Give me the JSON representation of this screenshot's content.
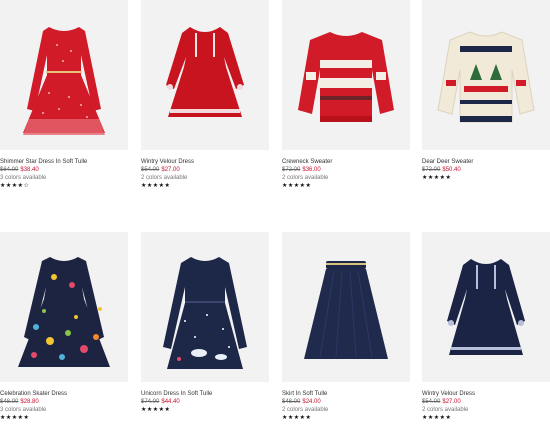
{
  "colors": {
    "sale_price": "#c4122f",
    "card_bg": "#f2f2f2",
    "red": "#d21b28",
    "navy": "#1d2748",
    "cream": "#f1ead9",
    "green": "#2d6b3a"
  },
  "products": [
    {
      "name": "Shimmer Star Dress In Soft Tulle",
      "orig_price": "$64.00",
      "sale_price": "$38.40",
      "colors": "3 colors available",
      "stars": "★★★★☆",
      "rating": 4.5,
      "icon": "red-tulle-dress"
    },
    {
      "name": "Wintry Velour Dress",
      "orig_price": "$54.00",
      "sale_price": "$27.00",
      "colors": "2 colors available",
      "stars": "★★★★★",
      "rating": 5,
      "icon": "red-velour-dress"
    },
    {
      "name": "Crewneck Sweater",
      "orig_price": "$72.00",
      "sale_price": "$36.00",
      "colors": "2 colors available",
      "stars": "★★★★★",
      "rating": 5,
      "icon": "red-fair-isle-sweater"
    },
    {
      "name": "Dear Deer Sweater",
      "orig_price": "$72.00",
      "sale_price": "$50.40",
      "colors": "",
      "stars": "★★★★★",
      "rating": 5,
      "icon": "cream-deer-sweater"
    },
    {
      "name": "Celebration Skater Dress",
      "orig_price": "$48.00",
      "sale_price": "$28.80",
      "colors": "3 colors available",
      "stars": "★★★★★",
      "rating": 5,
      "icon": "floral-skater-dress"
    },
    {
      "name": "Unicorn Dress In Soft Tulle",
      "orig_price": "$74.00",
      "sale_price": "$44.40",
      "colors": "",
      "stars": "★★★★★",
      "rating": 5,
      "icon": "navy-unicorn-dress"
    },
    {
      "name": "Skirt In Soft Tulle",
      "orig_price": "$48.00",
      "sale_price": "$24.00",
      "colors": "2 colors available",
      "stars": "★★★★★",
      "rating": 5,
      "icon": "navy-tulle-skirt"
    },
    {
      "name": "Wintry Velour Dress",
      "orig_price": "$54.00",
      "sale_price": "$27.00",
      "colors": "2 colors available",
      "stars": "★★★★★",
      "rating": 5,
      "icon": "navy-velour-dress"
    }
  ]
}
